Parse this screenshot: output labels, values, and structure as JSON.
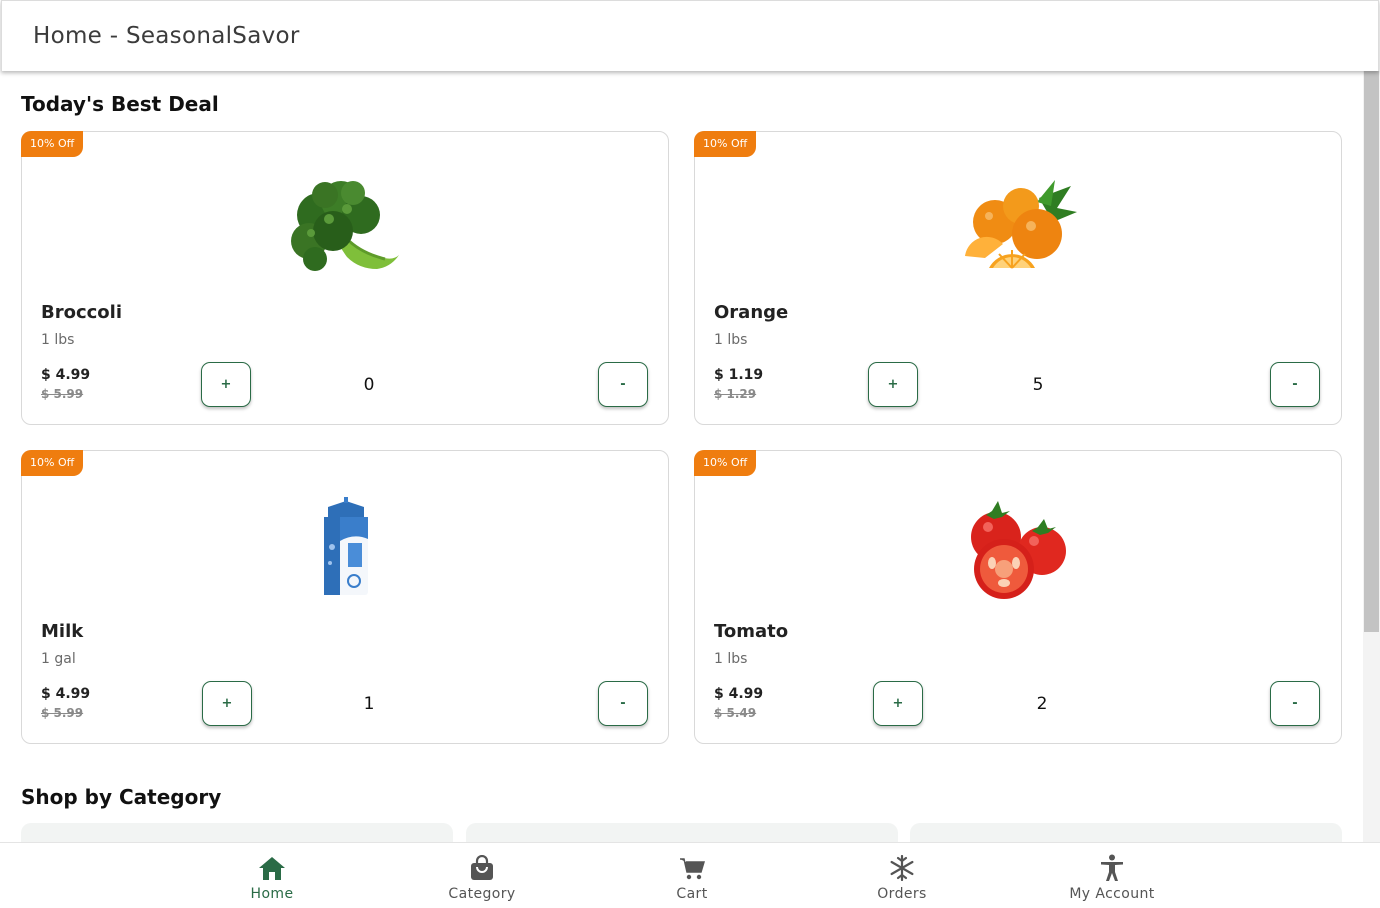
{
  "header": {
    "title": "Home - SeasonalSavor"
  },
  "sections": {
    "best_deal_title": "Today's Best Deal",
    "category_title": "Shop by Category"
  },
  "products": [
    {
      "badge": "10% Off",
      "name": "Broccoli",
      "unit": "1 lbs",
      "price": "$ 4.99",
      "old_price": "$ 5.99",
      "plus_label": "+",
      "minus_label": "-",
      "quantity": "0",
      "image_icon": "broccoli-image"
    },
    {
      "badge": "10% Off",
      "name": "Orange",
      "unit": "1 lbs",
      "price": "$ 1.19",
      "old_price": "$ 1.29",
      "plus_label": "+",
      "minus_label": "-",
      "quantity": "5",
      "image_icon": "orange-image"
    },
    {
      "badge": "10% Off",
      "name": "Milk",
      "unit": "1 gal",
      "price": "$ 4.99",
      "old_price": "$ 5.99",
      "plus_label": "+",
      "minus_label": "-",
      "quantity": "1",
      "image_icon": "milk-carton-image"
    },
    {
      "badge": "10% Off",
      "name": "Tomato",
      "unit": "1 lbs",
      "price": "$ 4.99",
      "old_price": "$ 5.49",
      "plus_label": "+",
      "minus_label": "-",
      "quantity": "2",
      "image_icon": "tomato-image"
    }
  ],
  "bottom_nav": [
    {
      "label": "Home",
      "icon": "home-icon",
      "active": true
    },
    {
      "label": "Category",
      "icon": "shopping-bag-icon",
      "active": false
    },
    {
      "label": "Cart",
      "icon": "cart-icon",
      "active": false
    },
    {
      "label": "Orders",
      "icon": "snowflake-icon",
      "active": false
    },
    {
      "label": "My Account",
      "icon": "person-icon",
      "active": false
    }
  ],
  "colors": {
    "accent_green": "#2a6b46",
    "badge_orange": "#ef7d0f",
    "nav_inactive": "#555555"
  }
}
